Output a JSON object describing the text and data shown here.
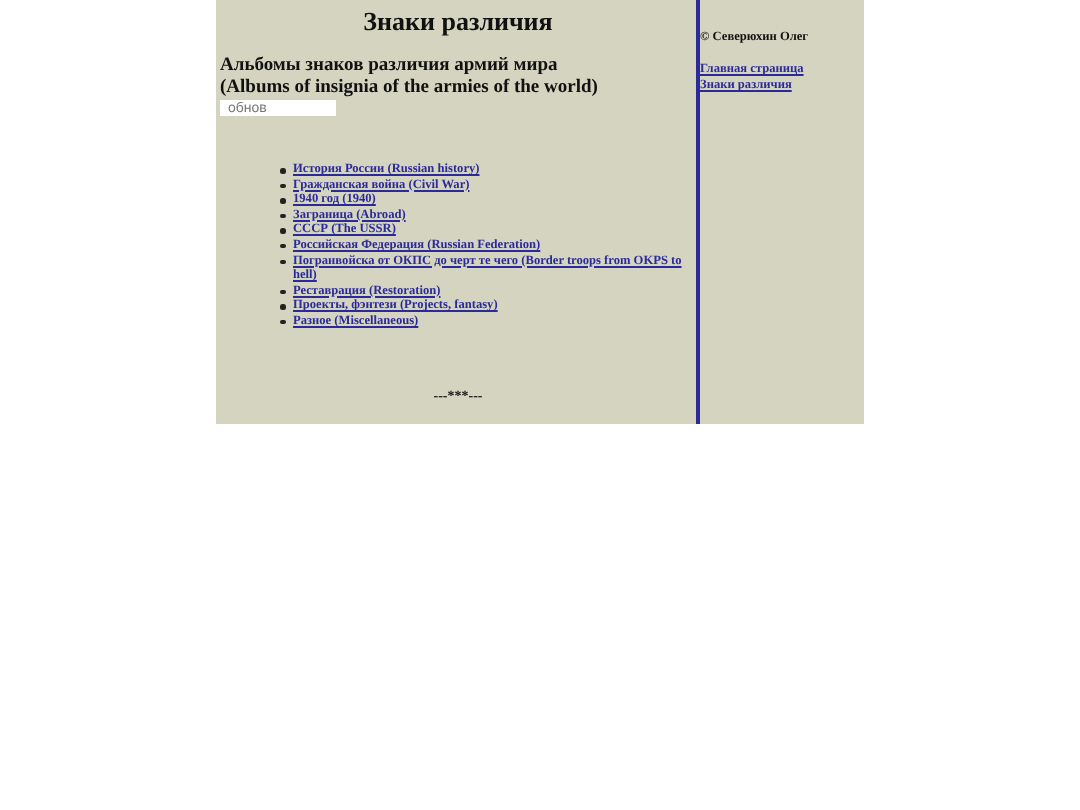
{
  "title": "Знаки различия",
  "subtitle": [
    "Альбомы знаков различия армий мира",
    "(Albums of insignia of the armies of the world)"
  ],
  "update_field": {
    "value": "обнов"
  },
  "links": [
    {
      "label": "История России (Russian history)"
    },
    {
      "label": "Гражданская война (Civil War)"
    },
    {
      "label": "1940 год (1940)"
    },
    {
      "label": "Заграница (Abroad)"
    },
    {
      "label": "СССР (The USSR)"
    },
    {
      "label": "Российская Федерация (Russian Federation)"
    },
    {
      "label": "Погранвойска от ОКПС до черт те чего (Border troops from OKPS to hell)"
    },
    {
      "label": "Реставрация (Restoration)"
    },
    {
      "label": "Проекты, фэнтези (Projects, fantasy)"
    },
    {
      "label": "Разное (Miscellaneous)"
    }
  ],
  "footer": "---***---",
  "sidebar": {
    "author": "© Северюхин Олег",
    "links": [
      {
        "label": "Главная страница"
      },
      {
        "label": "Знаки различия"
      }
    ]
  }
}
